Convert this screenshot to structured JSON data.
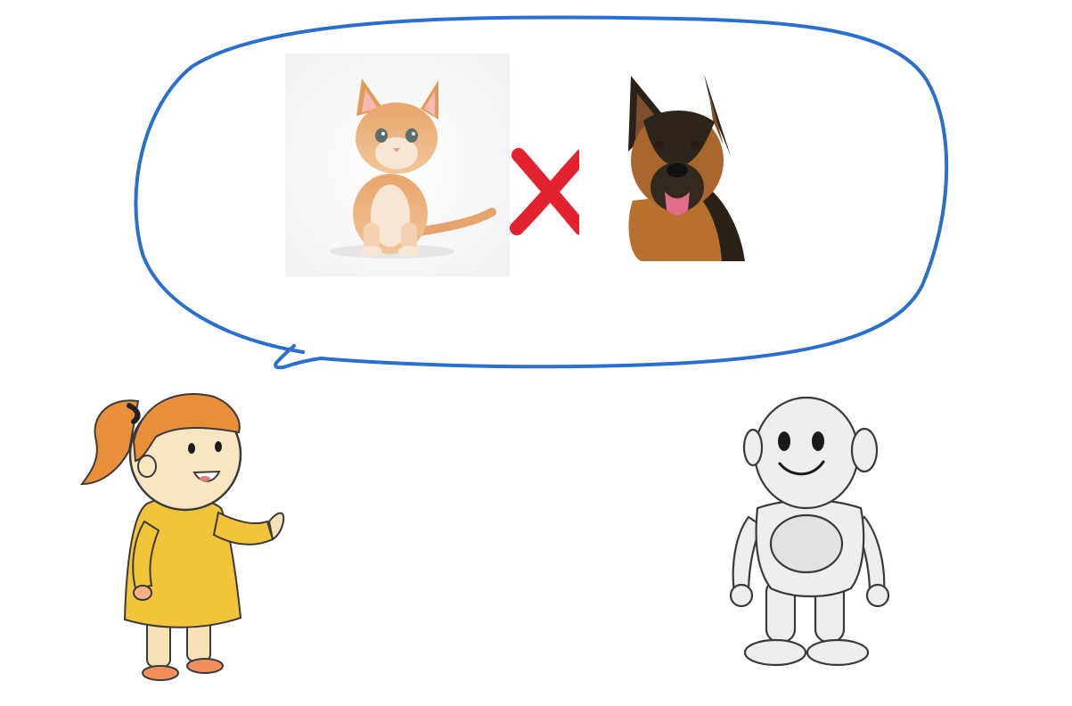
{
  "scene": {
    "bubble_color": "#2a6fce",
    "cross_color": "#e2222e",
    "speech_bubble": {
      "left_image": "kitten-photo",
      "separator": "red-cross-mark",
      "right_image": "german-shepherd-photo"
    },
    "characters": [
      "girl-drawing",
      "robot-drawing"
    ]
  }
}
